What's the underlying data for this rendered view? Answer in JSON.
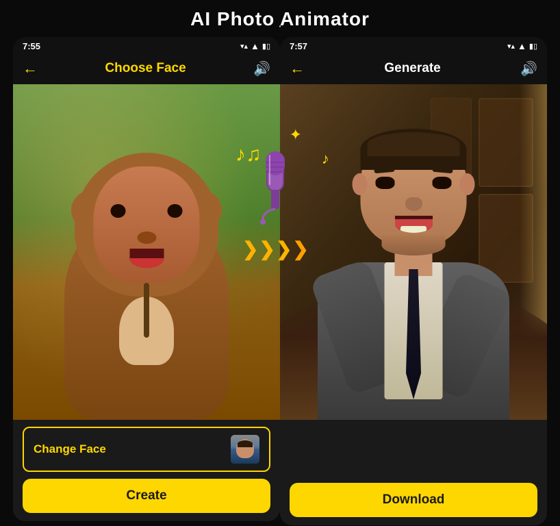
{
  "page": {
    "title": "AI Photo Animator",
    "bg_color": "#0a0a0a"
  },
  "left_phone": {
    "status": {
      "time": "7:55",
      "signal": "▼▲",
      "battery": "🔋"
    },
    "header": {
      "back_label": "←",
      "title": "Choose Face",
      "sound_label": "🔊"
    },
    "change_face_label": "Change Face",
    "create_label": "Create"
  },
  "right_phone": {
    "status": {
      "time": "7:57",
      "signal": "▼▲",
      "battery": "🔋"
    },
    "header": {
      "back_label": "←",
      "title": "Generate",
      "sound_label": "🔊"
    },
    "download_label": "Download"
  },
  "middle": {
    "arrows": "❯❯❯❯"
  }
}
